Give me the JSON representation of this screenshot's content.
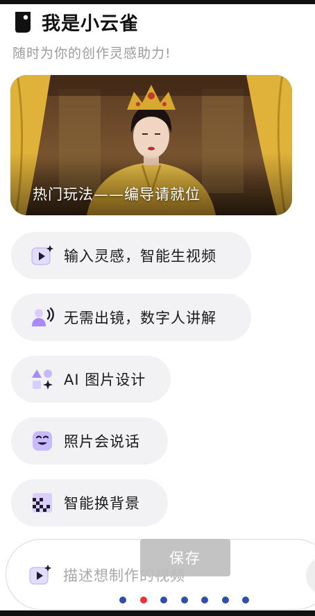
{
  "header": {
    "title": "我是小云雀",
    "subtitle": "随时为你的创作灵感助力!"
  },
  "banner": {
    "caption": "热门玩法——编导请就位"
  },
  "features": [
    {
      "label": "输入灵感，智能生视频",
      "icon": "video-sparkle-icon"
    },
    {
      "label": "无需出镜，数字人讲解",
      "icon": "avatar-speaking-icon"
    },
    {
      "label": "AI 图片设计",
      "icon": "shapes-sparkle-icon"
    },
    {
      "label": "照片会说话",
      "icon": "talking-face-icon"
    },
    {
      "label": "智能换背景",
      "icon": "background-swap-icon"
    }
  ],
  "composer": {
    "placeholder": "描述想制作的视频",
    "icon": "video-sparkle-icon"
  },
  "toast": {
    "label": "保存"
  },
  "pager": {
    "count": 7,
    "active_index": 1
  },
  "colors": {
    "accent_purple": "#7b5cf5",
    "icon_bg": "#e7e0ff",
    "pill_bg": "#f2f2f4",
    "dot_blue": "#2f4fa8",
    "dot_red": "#e8333a"
  }
}
